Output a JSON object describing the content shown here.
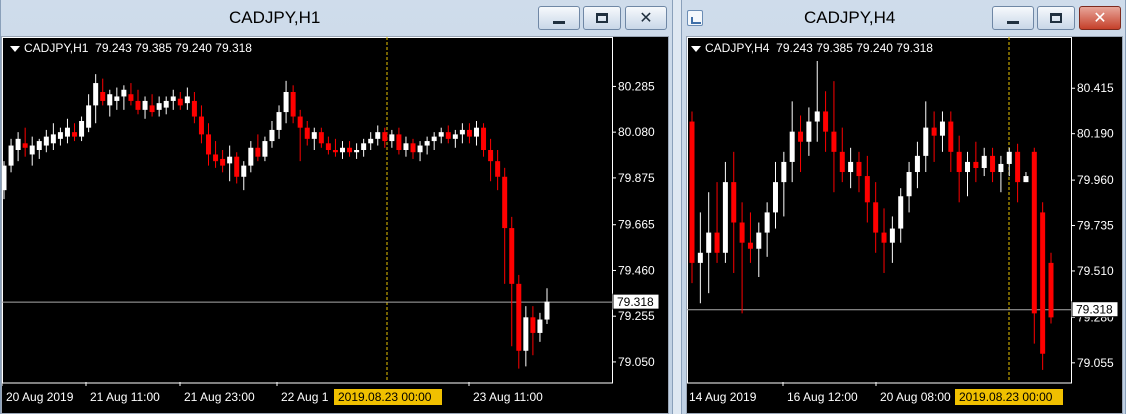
{
  "windows": [
    {
      "title": "CADJPY,H1",
      "info_symbol": "CADJPY,H1",
      "info_ohlc": "79.243 79.385 79.240 79.318",
      "buttons": {
        "minimize_icon": "minimize-icon",
        "maximize_icon": "maximize-icon",
        "close_icon": "close-icon",
        "close_glyph": "✕"
      },
      "price_levels": [
        "80.285",
        "80.080",
        "79.875",
        "79.665",
        "79.460",
        "79.255",
        "79.050"
      ],
      "current_price": "79.318",
      "time_labels": [
        "20 Aug 2019",
        "21 Aug 11:00",
        "21 Aug 23:00",
        "22 Aug 1",
        "2019.08.23 00:00",
        "23 Aug 11:00"
      ],
      "chart_data": {
        "type": "candlestick",
        "ylim": [
          78.96,
          80.39
        ],
        "current": 79.318,
        "up_color": "#ffffff",
        "down_color": "#ff0000",
        "candles": [
          [
            79.82,
            79.95,
            79.78,
            79.93
          ],
          [
            79.93,
            80.05,
            79.9,
            80.02
          ],
          [
            80.0,
            80.08,
            79.95,
            80.05
          ],
          [
            80.03,
            80.1,
            79.97,
            80.01
          ],
          [
            79.98,
            80.06,
            79.93,
            80.02
          ],
          [
            80.0,
            80.05,
            79.96,
            80.04
          ],
          [
            80.02,
            80.09,
            79.99,
            80.06
          ],
          [
            80.03,
            80.12,
            80.0,
            80.07
          ],
          [
            80.05,
            80.1,
            80.02,
            80.08
          ],
          [
            80.06,
            80.14,
            80.03,
            80.1
          ],
          [
            80.08,
            80.12,
            80.04,
            80.06
          ],
          [
            80.06,
            80.15,
            80.04,
            80.13
          ],
          [
            80.1,
            80.25,
            80.08,
            80.2
          ],
          [
            80.2,
            80.34,
            80.12,
            80.3
          ],
          [
            80.26,
            80.32,
            80.2,
            80.22
          ],
          [
            80.2,
            80.27,
            80.15,
            80.25
          ],
          [
            80.22,
            80.28,
            80.18,
            80.24
          ],
          [
            80.24,
            80.29,
            80.18,
            80.27
          ],
          [
            80.25,
            80.3,
            80.2,
            80.22
          ],
          [
            80.22,
            80.27,
            80.16,
            80.18
          ],
          [
            80.18,
            80.24,
            80.14,
            80.22
          ],
          [
            80.2,
            80.25,
            80.15,
            80.17
          ],
          [
            80.18,
            80.24,
            80.15,
            80.21
          ],
          [
            80.19,
            80.24,
            80.16,
            80.22
          ],
          [
            80.22,
            80.27,
            80.18,
            80.24
          ],
          [
            80.23,
            80.26,
            80.18,
            80.2
          ],
          [
            80.21,
            80.28,
            80.18,
            80.24
          ],
          [
            80.22,
            80.26,
            80.12,
            80.15
          ],
          [
            80.15,
            80.2,
            80.03,
            80.07
          ],
          [
            80.07,
            80.12,
            79.93,
            79.98
          ],
          [
            79.98,
            80.04,
            79.92,
            79.95
          ],
          [
            79.96,
            80.0,
            79.9,
            79.93
          ],
          [
            79.94,
            80.02,
            79.86,
            79.97
          ],
          [
            79.97,
            79.99,
            79.85,
            79.88
          ],
          [
            79.88,
            79.95,
            79.82,
            79.93
          ],
          [
            79.93,
            80.04,
            79.9,
            80.01
          ],
          [
            80.01,
            80.07,
            79.95,
            79.97
          ],
          [
            79.97,
            80.06,
            79.95,
            80.04
          ],
          [
            80.04,
            80.13,
            80.01,
            80.09
          ],
          [
            80.09,
            80.2,
            80.05,
            80.17
          ],
          [
            80.17,
            80.31,
            80.12,
            80.26
          ],
          [
            80.26,
            80.29,
            80.12,
            80.15
          ],
          [
            80.15,
            80.18,
            79.95,
            80.1
          ],
          [
            80.1,
            80.13,
            80.02,
            80.05
          ],
          [
            80.05,
            80.1,
            80.0,
            80.08
          ],
          [
            80.08,
            80.1,
            80.01,
            80.03
          ],
          [
            80.03,
            80.06,
            79.98,
            80.0
          ],
          [
            80.0,
            80.05,
            79.97,
            79.99
          ],
          [
            79.99,
            80.04,
            79.96,
            80.01
          ],
          [
            80.01,
            80.04,
            79.97,
            79.99
          ],
          [
            79.99,
            80.03,
            79.96,
            80.0
          ],
          [
            80.0,
            80.05,
            79.97,
            80.03
          ],
          [
            80.03,
            80.08,
            80.0,
            80.05
          ],
          [
            80.05,
            80.11,
            80.02,
            80.08
          ],
          [
            80.08,
            80.1,
            80.01,
            80.04
          ],
          [
            80.04,
            80.09,
            80.01,
            80.07
          ],
          [
            80.07,
            80.1,
            79.98,
            80.0
          ],
          [
            80.0,
            80.06,
            79.97,
            80.03
          ],
          [
            80.03,
            80.05,
            79.96,
            79.99
          ],
          [
            79.99,
            80.04,
            79.95,
            80.02
          ],
          [
            80.02,
            80.06,
            79.98,
            80.04
          ],
          [
            80.04,
            80.08,
            80.0,
            80.06
          ],
          [
            80.06,
            80.1,
            80.03,
            80.08
          ],
          [
            80.08,
            80.11,
            80.03,
            80.05
          ],
          [
            80.05,
            80.09,
            80.01,
            80.07
          ],
          [
            80.07,
            80.12,
            80.03,
            80.09
          ],
          [
            80.09,
            80.12,
            80.03,
            80.06
          ],
          [
            80.06,
            80.13,
            80.02,
            80.1
          ],
          [
            80.1,
            80.12,
            79.97,
            80.0
          ],
          [
            80.0,
            80.05,
            79.86,
            79.95
          ],
          [
            79.95,
            80.0,
            79.82,
            79.88
          ],
          [
            79.88,
            79.92,
            79.4,
            79.65
          ],
          [
            79.65,
            79.7,
            79.12,
            79.4
          ],
          [
            79.4,
            79.44,
            79.02,
            79.1
          ],
          [
            79.1,
            79.3,
            79.03,
            79.25
          ],
          [
            79.25,
            79.3,
            79.08,
            79.18
          ],
          [
            79.18,
            79.27,
            79.14,
            79.24
          ],
          [
            79.24,
            79.38,
            79.22,
            79.32
          ]
        ]
      }
    },
    {
      "title": "CADJPY,H4",
      "info_symbol": "CADJPY,H4",
      "info_ohlc": "79.243 79.385 79.240 79.318",
      "buttons": {
        "minimize_icon": "minimize-icon",
        "maximize_icon": "maximize-icon",
        "close_icon": "close-icon",
        "close_glyph": "✕"
      },
      "price_levels": [
        "80.415",
        "80.190",
        "79.960",
        "79.735",
        "79.510",
        "79.280",
        "79.055"
      ],
      "current_price": "79.318",
      "time_labels": [
        "14 Aug 2019",
        "16 Aug 12:00",
        "20 Aug 08:00",
        "2019.08.23 00:00"
      ],
      "chart_data": {
        "type": "candlestick",
        "ylim": [
          78.96,
          80.54
        ],
        "current": 79.318,
        "up_color": "#ffffff",
        "down_color": "#ff0000",
        "candles": [
          [
            80.25,
            80.3,
            79.45,
            79.55
          ],
          [
            79.55,
            79.8,
            79.35,
            79.6
          ],
          [
            79.6,
            79.9,
            79.4,
            79.7
          ],
          [
            79.7,
            79.95,
            79.55,
            79.6
          ],
          [
            79.6,
            80.05,
            79.55,
            79.95
          ],
          [
            79.95,
            80.1,
            79.5,
            79.75
          ],
          [
            79.75,
            79.85,
            79.3,
            79.65
          ],
          [
            79.65,
            79.8,
            79.55,
            79.62
          ],
          [
            79.62,
            79.75,
            79.48,
            79.7
          ],
          [
            79.7,
            79.85,
            79.58,
            79.8
          ],
          [
            79.8,
            80.05,
            79.72,
            79.95
          ],
          [
            79.95,
            80.1,
            79.78,
            80.05
          ],
          [
            80.05,
            80.35,
            79.95,
            80.2
          ],
          [
            80.2,
            80.28,
            80.0,
            80.15
          ],
          [
            80.15,
            80.32,
            80.08,
            80.25
          ],
          [
            80.25,
            80.55,
            80.15,
            80.3
          ],
          [
            80.3,
            80.4,
            80.1,
            80.2
          ],
          [
            80.2,
            80.45,
            79.9,
            80.1
          ],
          [
            80.1,
            80.22,
            79.95,
            80.0
          ],
          [
            80.0,
            80.12,
            79.92,
            80.05
          ],
          [
            80.05,
            80.1,
            79.9,
            79.98
          ],
          [
            79.98,
            80.08,
            79.75,
            79.85
          ],
          [
            79.85,
            79.95,
            79.6,
            79.7
          ],
          [
            79.7,
            79.82,
            79.5,
            79.65
          ],
          [
            79.65,
            79.78,
            79.55,
            79.72
          ],
          [
            79.72,
            79.92,
            79.65,
            79.88
          ],
          [
            79.88,
            80.05,
            79.8,
            80.0
          ],
          [
            80.0,
            80.15,
            79.92,
            80.08
          ],
          [
            80.08,
            80.35,
            80.0,
            80.22
          ],
          [
            80.22,
            80.3,
            80.05,
            80.18
          ],
          [
            80.18,
            80.3,
            80.1,
            80.25
          ],
          [
            80.25,
            80.3,
            80.0,
            80.1
          ],
          [
            80.1,
            80.18,
            79.85,
            80.0
          ],
          [
            80.0,
            80.1,
            79.88,
            80.05
          ],
          [
            80.05,
            80.15,
            79.95,
            80.02
          ],
          [
            80.02,
            80.12,
            79.98,
            80.08
          ],
          [
            80.08,
            80.12,
            79.95,
            80.0
          ],
          [
            80.0,
            80.08,
            79.9,
            80.04
          ],
          [
            80.04,
            80.12,
            79.98,
            80.1
          ],
          [
            80.1,
            80.14,
            79.85,
            79.95
          ],
          [
            79.95,
            80.0,
            79.95,
            79.98
          ],
          [
            80.1,
            80.12,
            79.15,
            79.3
          ],
          [
            79.8,
            79.85,
            79.02,
            79.1
          ],
          [
            79.55,
            79.6,
            79.25,
            79.28
          ]
        ]
      }
    }
  ]
}
